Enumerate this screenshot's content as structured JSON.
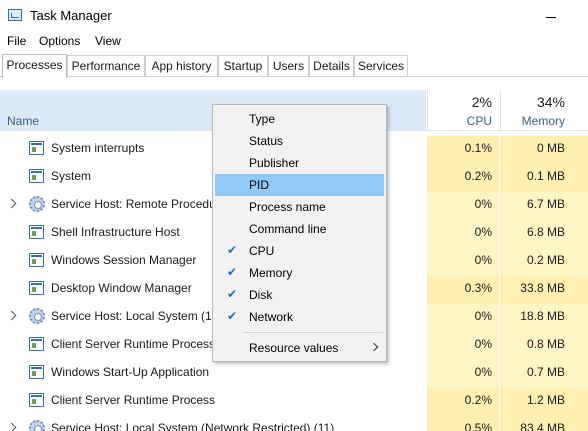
{
  "window": {
    "title": "Task Manager"
  },
  "menu": [
    "File",
    "Options",
    "View"
  ],
  "tabs": [
    "Processes",
    "Performance",
    "App history",
    "Startup",
    "Users",
    "Details",
    "Services"
  ],
  "active_tab": "Processes",
  "header": {
    "name_label": "Name",
    "cpu_pct": "2%",
    "cpu_label": "CPU",
    "mem_pct": "34%",
    "mem_label": "Memory"
  },
  "processes": [
    {
      "name": "System interrupts",
      "icon": "process-icon",
      "expandable": false,
      "cpu": "0.1%",
      "memory": "0 MB"
    },
    {
      "name": "System",
      "icon": "process-icon",
      "expandable": false,
      "cpu": "0.2%",
      "memory": "0.1 MB"
    },
    {
      "name": "Service Host: Remote Procedure Call (2)",
      "icon": "gear-icon",
      "expandable": true,
      "cpu": "0%",
      "memory": "6.7 MB"
    },
    {
      "name": "Shell Infrastructure Host",
      "icon": "process-icon",
      "expandable": false,
      "cpu": "0%",
      "memory": "6.8 MB"
    },
    {
      "name": "Windows Session Manager",
      "icon": "process-icon",
      "expandable": false,
      "cpu": "0%",
      "memory": "0.2 MB"
    },
    {
      "name": "Desktop Window Manager",
      "icon": "process-icon",
      "expandable": false,
      "cpu": "0.3%",
      "memory": "33.8 MB"
    },
    {
      "name": "Service Host: Local System (16)",
      "icon": "gear-icon",
      "expandable": true,
      "cpu": "0%",
      "memory": "18.8 MB"
    },
    {
      "name": "Client Server Runtime Process",
      "icon": "process-icon",
      "expandable": false,
      "cpu": "0%",
      "memory": "0.8 MB"
    },
    {
      "name": "Windows Start-Up Application",
      "icon": "process-icon",
      "expandable": false,
      "cpu": "0%",
      "memory": "0.7 MB"
    },
    {
      "name": "Client Server Runtime Process",
      "icon": "process-icon",
      "expandable": false,
      "cpu": "0.2%",
      "memory": "1.2 MB"
    },
    {
      "name": "Service Host: Local System (Network Restricted) (11)",
      "icon": "gear-icon",
      "expandable": true,
      "cpu": "0.5%",
      "memory": "83.4 MB"
    }
  ],
  "context_menu": {
    "items": [
      {
        "label": "Type",
        "checked": false
      },
      {
        "label": "Status",
        "checked": false
      },
      {
        "label": "Publisher",
        "checked": false
      },
      {
        "label": "PID",
        "checked": false,
        "highlighted": true
      },
      {
        "label": "Process name",
        "checked": false
      },
      {
        "label": "Command line",
        "checked": false
      },
      {
        "label": "CPU",
        "checked": true
      },
      {
        "label": "Memory",
        "checked": true
      },
      {
        "label": "Disk",
        "checked": true
      },
      {
        "label": "Network",
        "checked": true
      }
    ],
    "submenu_label": "Resource values",
    "check_glyph": "✔"
  },
  "colors": {
    "header_highlight": "#dceaf7",
    "heat_cell": "#fff4c4",
    "menu_highlight": "#91c9f7",
    "check": "#1f6fc7"
  }
}
